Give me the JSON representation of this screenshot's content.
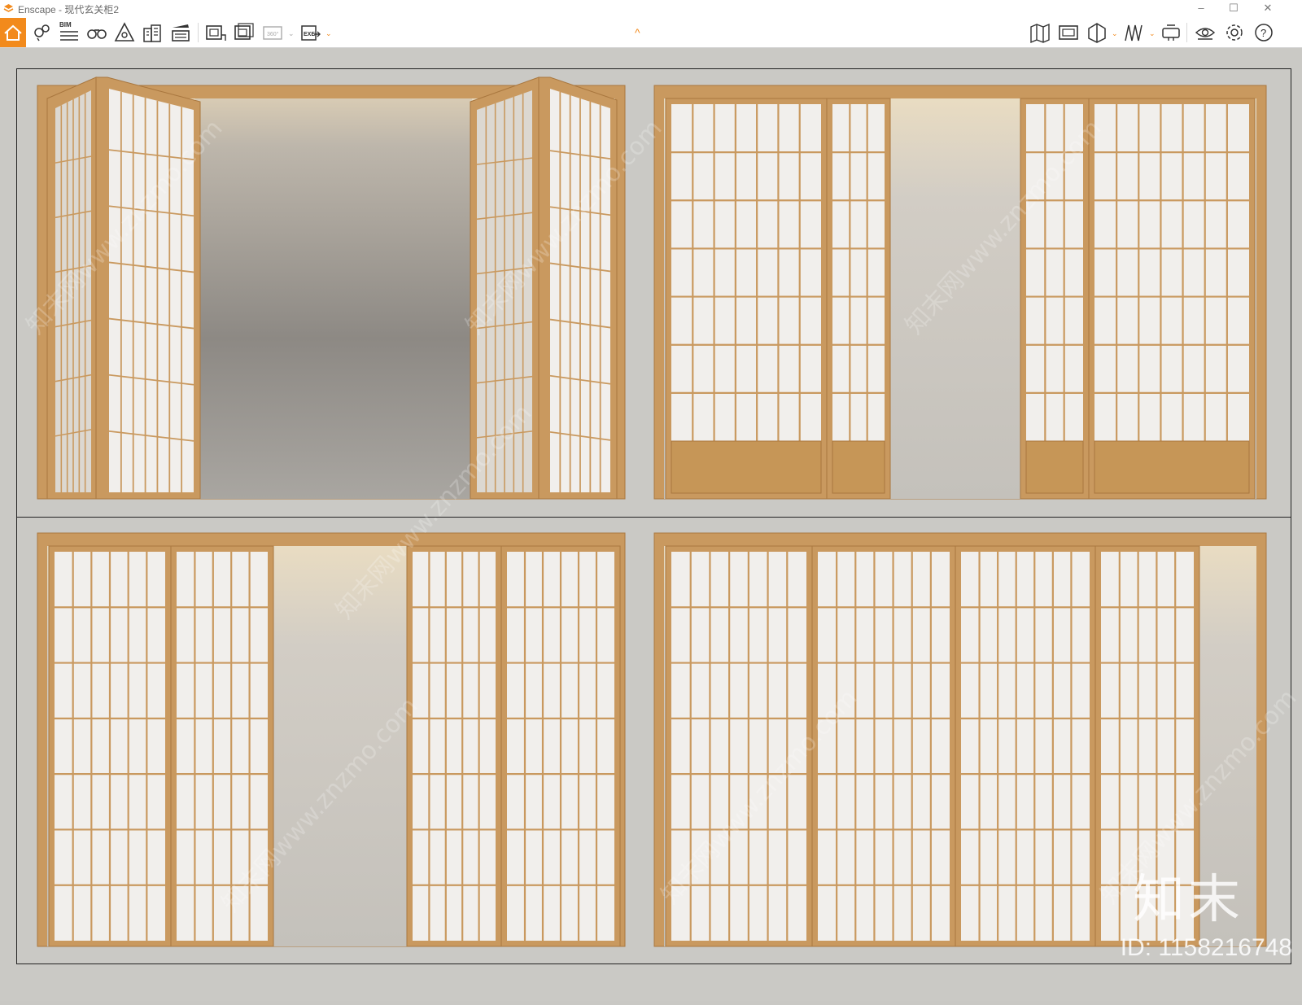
{
  "window": {
    "title": "Enscape - 现代玄关柜2",
    "minimize": "–",
    "maximize": "☐",
    "close": "✕"
  },
  "toolbar": {
    "bim_label": "BIM",
    "collapse_glyph": "^",
    "accent": "#f28a1c",
    "icons": [
      "home-icon",
      "location-pin-icon",
      "bim-list-icon",
      "binoculars-icon",
      "asset-library-icon",
      "buildings-icon",
      "clapper-icon",
      "screenshot-icon",
      "batch-render-icon",
      "panorama-360-icon",
      "export-exe-icon",
      "map-icon",
      "render-view-icon",
      "section-icon",
      "book-icon",
      "vr-headset-icon",
      "visibility-icon",
      "settings-gear-icon",
      "help-icon"
    ]
  },
  "watermark": {
    "logo": "知末",
    "id": "ID: 1158216748",
    "diagonal": "知末网www.znzmo.com"
  },
  "colors": {
    "wood": "#c9995f",
    "wood_dark": "#a9773f",
    "paper": "#f1efec",
    "wall": "#cac9c5"
  }
}
